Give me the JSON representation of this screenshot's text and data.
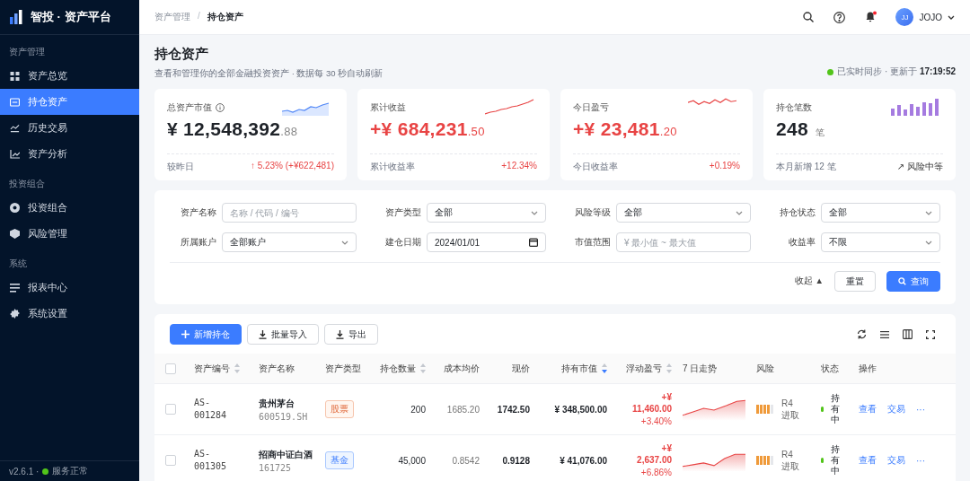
{
  "sidebar": {
    "logo": "智投 · 资产平台",
    "groups": [
      {
        "title": "资产管理",
        "items": [
          {
            "label": "资产总览",
            "selected": false
          },
          {
            "label": "持仓资产",
            "selected": true
          },
          {
            "label": "历史交易",
            "selected": false
          },
          {
            "label": "资产分析",
            "selected": false
          }
        ]
      },
      {
        "title": "投资组合",
        "items": [
          {
            "label": "投资组合",
            "selected": false
          },
          {
            "label": "风险管理",
            "selected": false
          }
        ]
      },
      {
        "title": "系统",
        "items": [
          {
            "label": "报表中心",
            "selected": false
          },
          {
            "label": "系统设置",
            "selected": false
          }
        ]
      }
    ],
    "footer": {
      "version": "v2.6.1 ·",
      "status": "服务正常"
    }
  },
  "header": {
    "breadcrumb": [
      "资产管理",
      "/",
      "持仓资产"
    ],
    "notifications_unread": true,
    "user": {
      "initials": "JJ",
      "name": "JOJO"
    }
  },
  "page": {
    "title": "持仓资产",
    "subtitle": "查看和管理你的全部金融投资资产 · 数据每 30 秒自动刷新",
    "sync": "已实时同步 · 更新于 **17:19:52**"
  },
  "cards": [
    {
      "label": "总资产市值",
      "info": true,
      "kind": "area",
      "value": "¥ 12,548,392",
      "decimals": ".88",
      "positive": false,
      "foot_label": "较昨日",
      "foot_value": "↑ 5.23% (+¥622,481)",
      "foot_positive": true
    },
    {
      "label": "累计收益",
      "info": false,
      "kind": "line",
      "value": "+¥ 684,231",
      "decimals": ".50",
      "positive": true,
      "foot_label": "累计收益率",
      "foot_value": "+12.34%",
      "foot_positive": true
    },
    {
      "label": "今日盈亏",
      "info": false,
      "kind": "zigzag",
      "value": "+¥ 23,481",
      "decimals": ".20",
      "positive": true,
      "foot_label": "今日收益率",
      "foot_value": "+0.19%",
      "foot_positive": true
    },
    {
      "label": "持仓笔数",
      "info": false,
      "kind": "bars",
      "value": "248",
      "unit": "笔",
      "positive": false,
      "foot_label": "本月新增 12 笔",
      "foot_value": "↗ 风险中等",
      "foot_positive": false
    }
  ],
  "filters": [
    {
      "label": "资产名称",
      "kind": "text",
      "placeholder": "名称 / 代码 / 编号"
    },
    {
      "label": "资产类型",
      "kind": "select",
      "value": "全部"
    },
    {
      "label": "风险等级",
      "kind": "select",
      "value": "全部"
    },
    {
      "label": "持仓状态",
      "kind": "select",
      "value": "全部"
    },
    {
      "label": "所属账户",
      "kind": "select",
      "value": "全部账户"
    },
    {
      "label": "建仓日期",
      "kind": "date",
      "value": "2024/01/01"
    },
    {
      "label": "市值范围",
      "kind": "text",
      "placeholder": "¥ 最小值 ~ 最大值"
    },
    {
      "label": "收益率",
      "kind": "select",
      "value": "不限"
    }
  ],
  "filter_actions": {
    "collapse": "收起 ▲",
    "reset": "重置",
    "search": "查询"
  },
  "toolbar": {
    "buttons": [
      {
        "label": "新增持仓",
        "kind": "primary"
      },
      {
        "label": "批量导入",
        "kind": "import"
      },
      {
        "label": "导出",
        "kind": "export"
      }
    ]
  },
  "table": {
    "select_all": {
      "checked": false
    },
    "columns": [
      {
        "label": "资产编号",
        "sortable": true,
        "sorted_desc": false
      },
      {
        "label": "资产名称"
      },
      {
        "label": "资产类型"
      },
      {
        "label": "持仓数量",
        "sortable": true,
        "sorted_desc": false
      },
      {
        "label": "成本均价"
      },
      {
        "label": "现价"
      },
      {
        "label": "持有市值",
        "sortable": true,
        "sorted_desc": true
      },
      {
        "label": "浮动盈亏",
        "sortable": true,
        "sorted_desc": false
      },
      {
        "label": "7 日走势"
      },
      {
        "label": "风险"
      },
      {
        "label": "状态"
      },
      {
        "label": "操作"
      }
    ],
    "rows": [
      {
        "selected": false,
        "id": "AS-001284",
        "name": "贵州茅台",
        "code": "600519.SH",
        "type": {
          "label": "股票",
          "kind": "stock"
        },
        "qty": "200",
        "cost": "1685.20",
        "price": "1742.50",
        "value": "¥ 348,500.00",
        "pnl": "+¥ 11,460.00",
        "pnl_pct": "+3.40%",
        "level": 0.8,
        "risk": "R4",
        "risk_label": "进取",
        "status": "持有中",
        "actions": [
          "查看",
          "交易",
          "···"
        ]
      },
      {
        "selected": false,
        "id": "AS-001305",
        "name": "招商中证白酒",
        "code": "161725",
        "type": {
          "label": "基金",
          "kind": "fund"
        },
        "qty": "45,000",
        "cost": "0.8542",
        "price": "0.9128",
        "value": "¥ 41,076.00",
        "pnl": "+¥ 2,637.00",
        "pnl_pct": "+6.86%",
        "level": 0.8,
        "risk": "R4",
        "risk_label": "进取",
        "status": "持有中",
        "actions": [
          "查看",
          "交易",
          "···"
        ]
      }
    ]
  }
}
